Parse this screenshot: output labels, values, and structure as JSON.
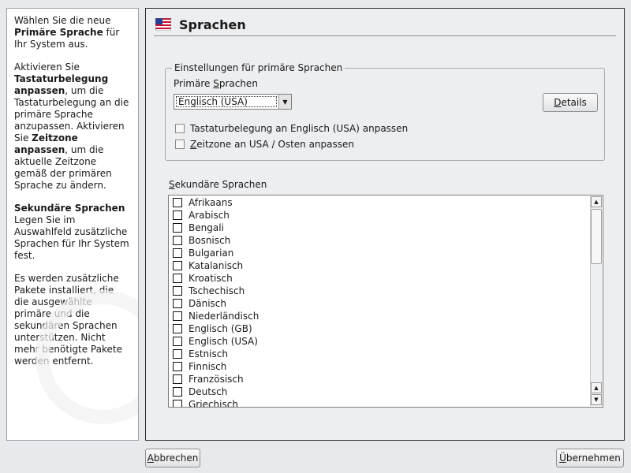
{
  "help": {
    "p1_before": "Wählen Sie die neue ",
    "p1_bold": "Primäre Sprache",
    "p1_after": " für Ihr System aus.",
    "p2_a": "Aktivieren Sie ",
    "p2_b": "Tastaturbelegung anpassen",
    "p2_c": ", um die Tastaturbelegung an die primäre Sprache anzupassen. Aktivieren Sie ",
    "p2_d": "Zeitzone anpassen",
    "p2_e": ", um die aktuelle Zeitzone gemäß der primären Sprache zu ändern.",
    "p3_bold": "Sekundäre Sprachen",
    "p3_text": "Legen Sie im Auswahlfeld zusätzliche Sprachen für Ihr System fest.",
    "p4": "Es werden zusätzliche Pakete installiert, die die ausgewählte primäre und die sekundären Sprachen unterstützen. Nicht mehr benötigte Pakete werden entfernt."
  },
  "header": {
    "title": "Sprachen",
    "icon": "us-flag-icon"
  },
  "primary": {
    "group_title": "Einstellungen für primäre Sprachen",
    "label_pre": "Primäre ",
    "label_mnemonic": "S",
    "label_post": "prachen",
    "selected": "Englisch (USA)",
    "details_mnemonic": "D",
    "details_rest": "etails",
    "keyboard_checkbox": "Tastaturbelegung an Englisch (USA) anpassen",
    "keyboard_checked": false,
    "timezone_mnemonic": "Z",
    "timezone_rest": "eitzone an USA / Osten anpassen",
    "timezone_checked": false
  },
  "secondary": {
    "label_mnemonic": "S",
    "label_rest": "ekundäre Sprachen",
    "languages": [
      "Afrikaans",
      "Arabisch",
      "Bengali",
      "Bosnisch",
      "Bulgarian",
      "Katalanisch",
      "Kroatisch",
      "Tschechisch",
      "Dänisch",
      "Niederländisch",
      "Englisch (GB)",
      "Englisch (USA)",
      "Estnisch",
      "Finnisch",
      "Französisch",
      "Deutsch",
      "Griechisch"
    ]
  },
  "footer": {
    "cancel_mnemonic": "A",
    "cancel_rest": "bbrechen",
    "accept_mnemonic": "Ü",
    "accept_rest": "bernehmen"
  }
}
